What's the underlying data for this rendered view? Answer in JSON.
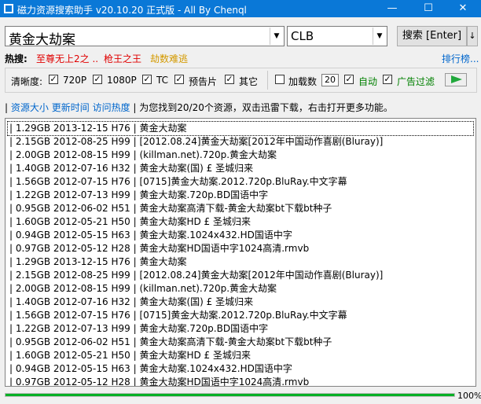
{
  "window": {
    "title": "磁力资源搜索助手 v20.10.20 正式版 - All By Chenql",
    "min": "—",
    "max": "☐",
    "close": "✕"
  },
  "search": {
    "query": "黄金大劫案",
    "site": "CLB",
    "button": "搜索 [Enter]",
    "arrow": "↓"
  },
  "hot": {
    "label": "热搜:",
    "items": [
      {
        "text": "至尊无上2之 ..",
        "color": "#e00000"
      },
      {
        "text": "枪王之王",
        "color": "#e00000"
      },
      {
        "text": "劫数难逃",
        "color": "#d49a00"
      }
    ],
    "rank": "排行榜..."
  },
  "options": {
    "clarity_label": "清晰度:",
    "c720": "720P",
    "c1080": "1080P",
    "tc": "TC",
    "trailer": "预告片",
    "other": "其它",
    "load_label": "加载数",
    "load_count": "20",
    "auto": "自动",
    "adfilter": "广告过滤",
    "check": "✓"
  },
  "sort": {
    "pipe1": "|",
    "size": "资源大小",
    "time": "更新时间",
    "hot": "访问热度",
    "info": "| 为您找到20/20个资源，双击迅雷下载，右击打开更多功能。"
  },
  "results": [
    "| 1.29GB 2013-12-15 H76 | 黄金大劫案",
    "| 2.15GB 2012-08-25 H99 | [2012.08.24]黄金大劫案[2012年中国动作喜剧(Bluray)]",
    "| 2.00GB 2012-08-15 H99 | (killman.net).720p.黄金大劫案",
    "| 1.40GB 2012-07-16 H32 | 黄金大劫案(国) £ 圣城归来",
    "| 1.56GB 2012-07-15 H76 | [0715]黄金大劫案.2012.720p.BluRay.中文字幕",
    "| 1.22GB 2012-07-13 H99 | 黄金大劫案.720p.BD国语中字",
    "| 0.95GB 2012-06-02 H51 | 黄金大劫案高清下载-黄金大劫案bt下载bt种子",
    "| 1.60GB 2012-05-21 H50 | 黄金大劫案HD £ 圣城归来",
    "| 0.94GB 2012-05-15 H63 | 黄金大劫案.1024x432.HD国语中字",
    "| 0.97GB 2012-05-12 H28 | 黄金大劫案HD国语中字1024高清.rmvb",
    "| 1.29GB 2013-12-15 H76 | 黄金大劫案",
    "| 2.15GB 2012-08-25 H99 | [2012.08.24]黄金大劫案[2012年中国动作喜剧(Bluray)]",
    "| 2.00GB 2012-08-15 H99 | (killman.net).720p.黄金大劫案",
    "| 1.40GB 2012-07-16 H32 | 黄金大劫案(国) £ 圣城归来",
    "| 1.56GB 2012-07-15 H76 | [0715]黄金大劫案.2012.720p.BluRay.中文字幕",
    "| 1.22GB 2012-07-13 H99 | 黄金大劫案.720p.BD国语中字",
    "| 0.95GB 2012-06-02 H51 | 黄金大劫案高清下载-黄金大劫案bt下载bt种子",
    "| 1.60GB 2012-05-21 H50 | 黄金大劫案HD £ 圣城归来",
    "| 0.94GB 2012-05-15 H63 | 黄金大劫案.1024x432.HD国语中字",
    "| 0.97GB 2012-05-12 H28 | 黄金大劫案HD国语中字1024高清.rmvb"
  ],
  "progress": {
    "value": 100,
    "label": "100%"
  },
  "colors": {
    "titlebar": "#0a78d7",
    "link": "#0066cc",
    "progress": "#06b025",
    "play": "#21a83c"
  }
}
